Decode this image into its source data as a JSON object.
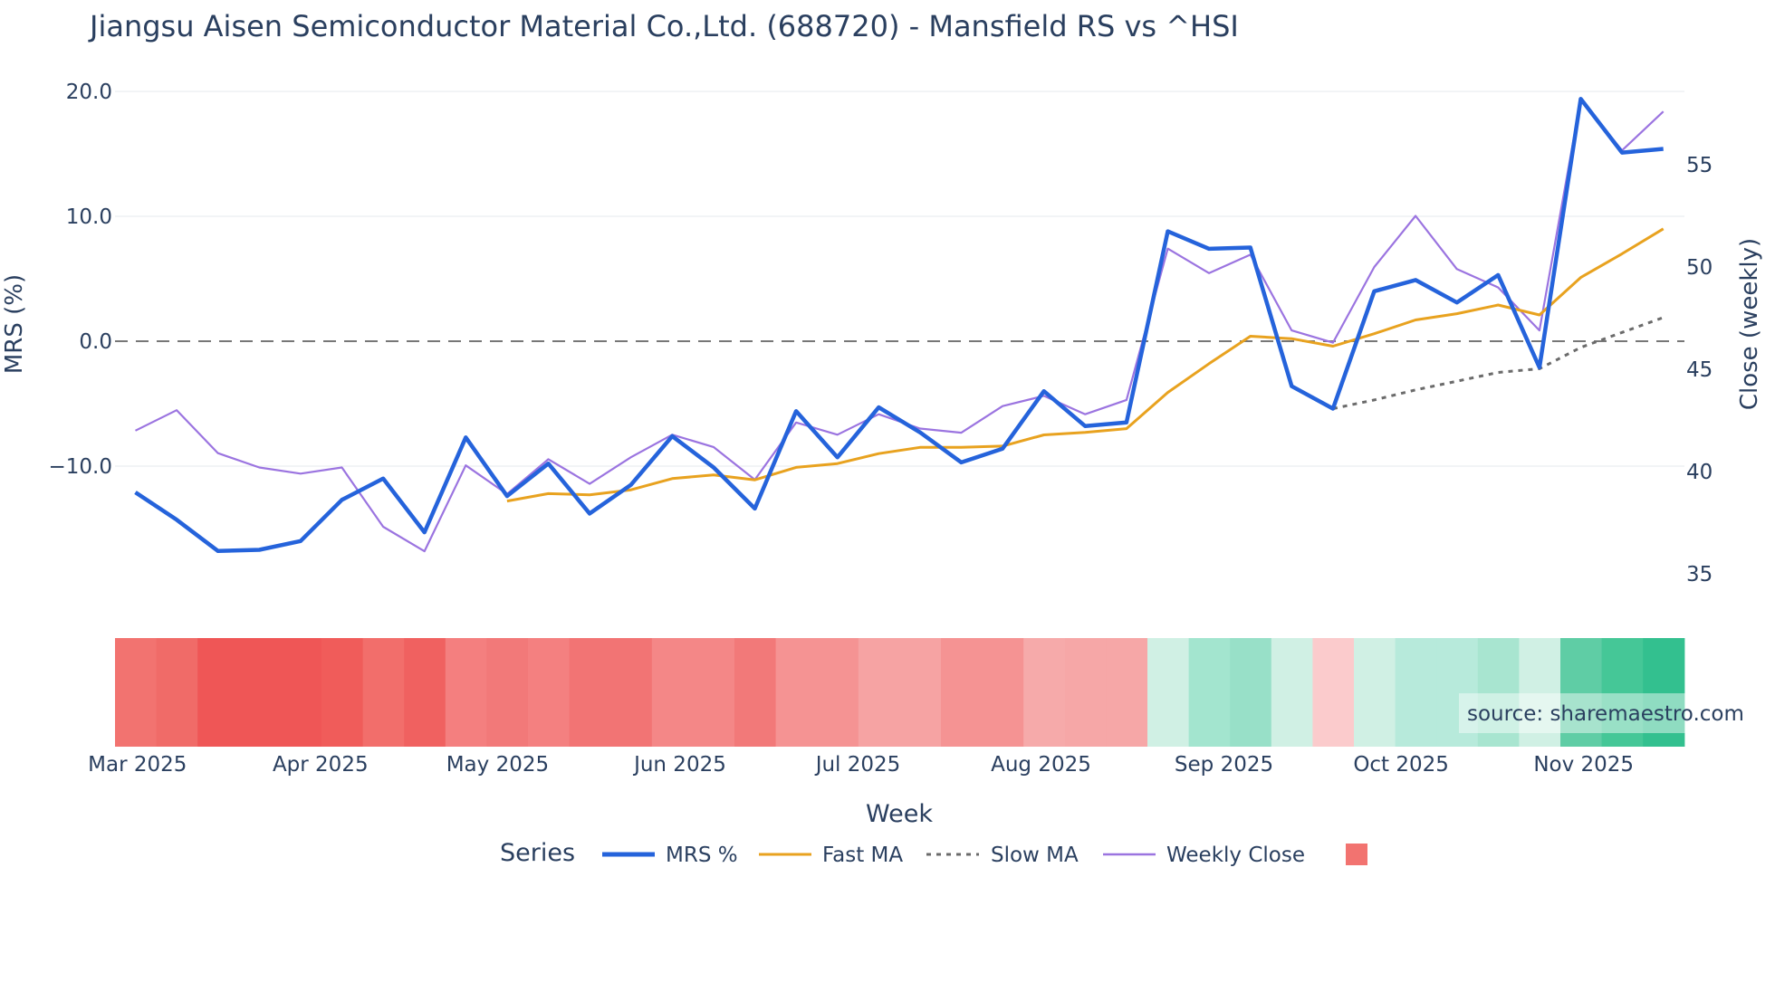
{
  "chart_data": {
    "type": "line",
    "title": "Jiangsu Aisen Semiconductor Material Co.,Ltd. (688720) - Mansfield RS vs ^HSI",
    "xlabel": "Week",
    "ylabel": "MRS (%)",
    "y2label": "Close (weekly)",
    "ylim": [
      -19,
      22
    ],
    "y2lim": [
      33,
      60
    ],
    "yticks": [
      "20.0",
      "10.0",
      "0.0",
      "−10.0"
    ],
    "ytick_values": [
      20,
      10,
      0,
      -10
    ],
    "y2ticks": [
      "55",
      "50",
      "45",
      "40",
      "35"
    ],
    "y2tick_values": [
      55,
      50,
      45,
      40,
      35
    ],
    "xticks": [
      "Mar 2025",
      "Apr 2025",
      "May 2025",
      "Jun 2025",
      "Jul 2025",
      "Aug 2025",
      "Sep 2025",
      "Oct 2025",
      "Nov 2025"
    ],
    "xtick_week_index": [
      0.05,
      4.48,
      8.77,
      13.19,
      17.5,
      21.93,
      26.36,
      30.65,
      35.07
    ],
    "grid": true,
    "legend_title": "Series",
    "legend_placement": "bottom-center",
    "source": "source: sharemaestro.com",
    "weeks": 38,
    "series": [
      {
        "name": "MRS %",
        "color": "#2563db",
        "axis": "left",
        "start": 0,
        "values": [
          -12.1,
          -14.3,
          -16.8,
          -16.7,
          -16.0,
          -12.7,
          -11.0,
          -15.3,
          -7.7,
          -12.4,
          -9.8,
          -13.8,
          -11.5,
          -7.6,
          -10.1,
          -13.4,
          -5.6,
          -9.3,
          -5.3,
          -7.3,
          -9.7,
          -8.6,
          -4.0,
          -6.8,
          -6.5,
          8.8,
          7.4,
          7.5,
          -3.6,
          -5.4,
          4.0,
          4.9,
          3.1,
          5.3,
          -2.1,
          19.4,
          15.1,
          15.4
        ]
      },
      {
        "name": "Fast MA",
        "color": "#e8a21f",
        "axis": "left",
        "start": 9,
        "values": [
          -12.8,
          -12.2,
          -12.3,
          -11.9,
          -11.0,
          -10.7,
          -11.1,
          -10.1,
          -9.8,
          -9.0,
          -8.5,
          -8.5,
          -8.4,
          -7.5,
          -7.3,
          -7.0,
          -4.1,
          -1.8,
          0.4,
          0.2,
          -0.4,
          0.6,
          1.7,
          2.2,
          2.9,
          2.1,
          5.1,
          7.0,
          9.0
        ]
      },
      {
        "name": "Slow MA",
        "color": "#6b6b6b",
        "axis": "left",
        "start": 29,
        "dash": true,
        "values": [
          -5.4,
          -4.7,
          -3.9,
          -3.2,
          -2.5,
          -2.2,
          -0.5,
          0.7,
          1.9
        ]
      },
      {
        "name": "Weekly Close",
        "color": "#9b74e0",
        "axis": "right",
        "start": 0,
        "values": [
          42.0,
          43.0,
          40.9,
          40.2,
          39.9,
          40.2,
          37.3,
          36.1,
          40.3,
          38.9,
          40.6,
          39.4,
          40.7,
          41.8,
          41.2,
          39.6,
          42.4,
          41.8,
          42.8,
          42.1,
          41.9,
          43.2,
          43.7,
          42.8,
          43.5,
          50.9,
          49.7,
          50.6,
          46.9,
          46.3,
          50.0,
          52.5,
          49.9,
          49.0,
          46.9,
          58.2,
          55.7,
          57.6
        ]
      }
    ],
    "heat_colors": [
      "#f27370",
      "#f06b68",
      "#ef5656",
      "#ef5656",
      "#ef5656",
      "#f05c5a",
      "#f26e6b",
      "#f06160",
      "#f47f7f",
      "#f27979",
      "#f48080",
      "#f27474",
      "#f27474",
      "#f48787",
      "#f48787",
      "#f27979",
      "#f59393",
      "#f59393",
      "#f6a3a3",
      "#f6a3a3",
      "#f59393",
      "#f59393",
      "#f6aaaa",
      "#f6a7a7",
      "#f6a7a7",
      "#d0f0e4",
      "#a3e5cf",
      "#98e0c8",
      "#d0f0e4",
      "#fbcbcc",
      "#d0f0e4",
      "#b7eadb",
      "#b7eadb",
      "#a8e5d0",
      "#d0f0e4",
      "#5fcda5",
      "#45c797",
      "#33c08f"
    ],
    "legend_swatch_color": "#f27370"
  }
}
